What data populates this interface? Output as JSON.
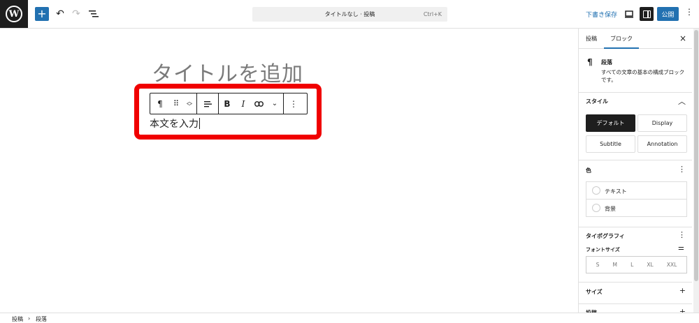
{
  "topbar": {
    "command_title": "タイトルなし · 投稿",
    "command_shortcut": "Ctrl+K",
    "save_draft": "下書き保存",
    "publish": "公開",
    "add": "+",
    "more": "⋮"
  },
  "canvas": {
    "title_placeholder": "タイトルを追加",
    "paragraph_placeholder": "本文を入力"
  },
  "block_toolbar": {
    "paragraph_icon": "¶",
    "bold": "B",
    "italic": "I"
  },
  "sidebar": {
    "tabs": {
      "post": "投稿",
      "block": "ブロック"
    },
    "close": "×",
    "block_name": "段落",
    "block_desc": "すべての文章の基本の構成ブロックです。",
    "style": {
      "heading": "スタイル",
      "options": [
        "デフォルト",
        "Display",
        "Subtitle",
        "Annotation"
      ],
      "selected": "デフォルト"
    },
    "color": {
      "heading": "色",
      "items": [
        "テキスト",
        "背景"
      ]
    },
    "typography": {
      "heading": "タイポグラフィ",
      "font_size_label": "フォントサイズ",
      "sizes": [
        "S",
        "M",
        "L",
        "XL",
        "XXL"
      ]
    },
    "size_heading": "サイズ",
    "next_heading": "投稿"
  },
  "footer": {
    "breadcrumb": [
      "投稿",
      "段落"
    ],
    "separator": "›"
  },
  "colors": {
    "accent": "#2271b1",
    "highlight": "#f00000",
    "dark": "#1e1e1e"
  }
}
